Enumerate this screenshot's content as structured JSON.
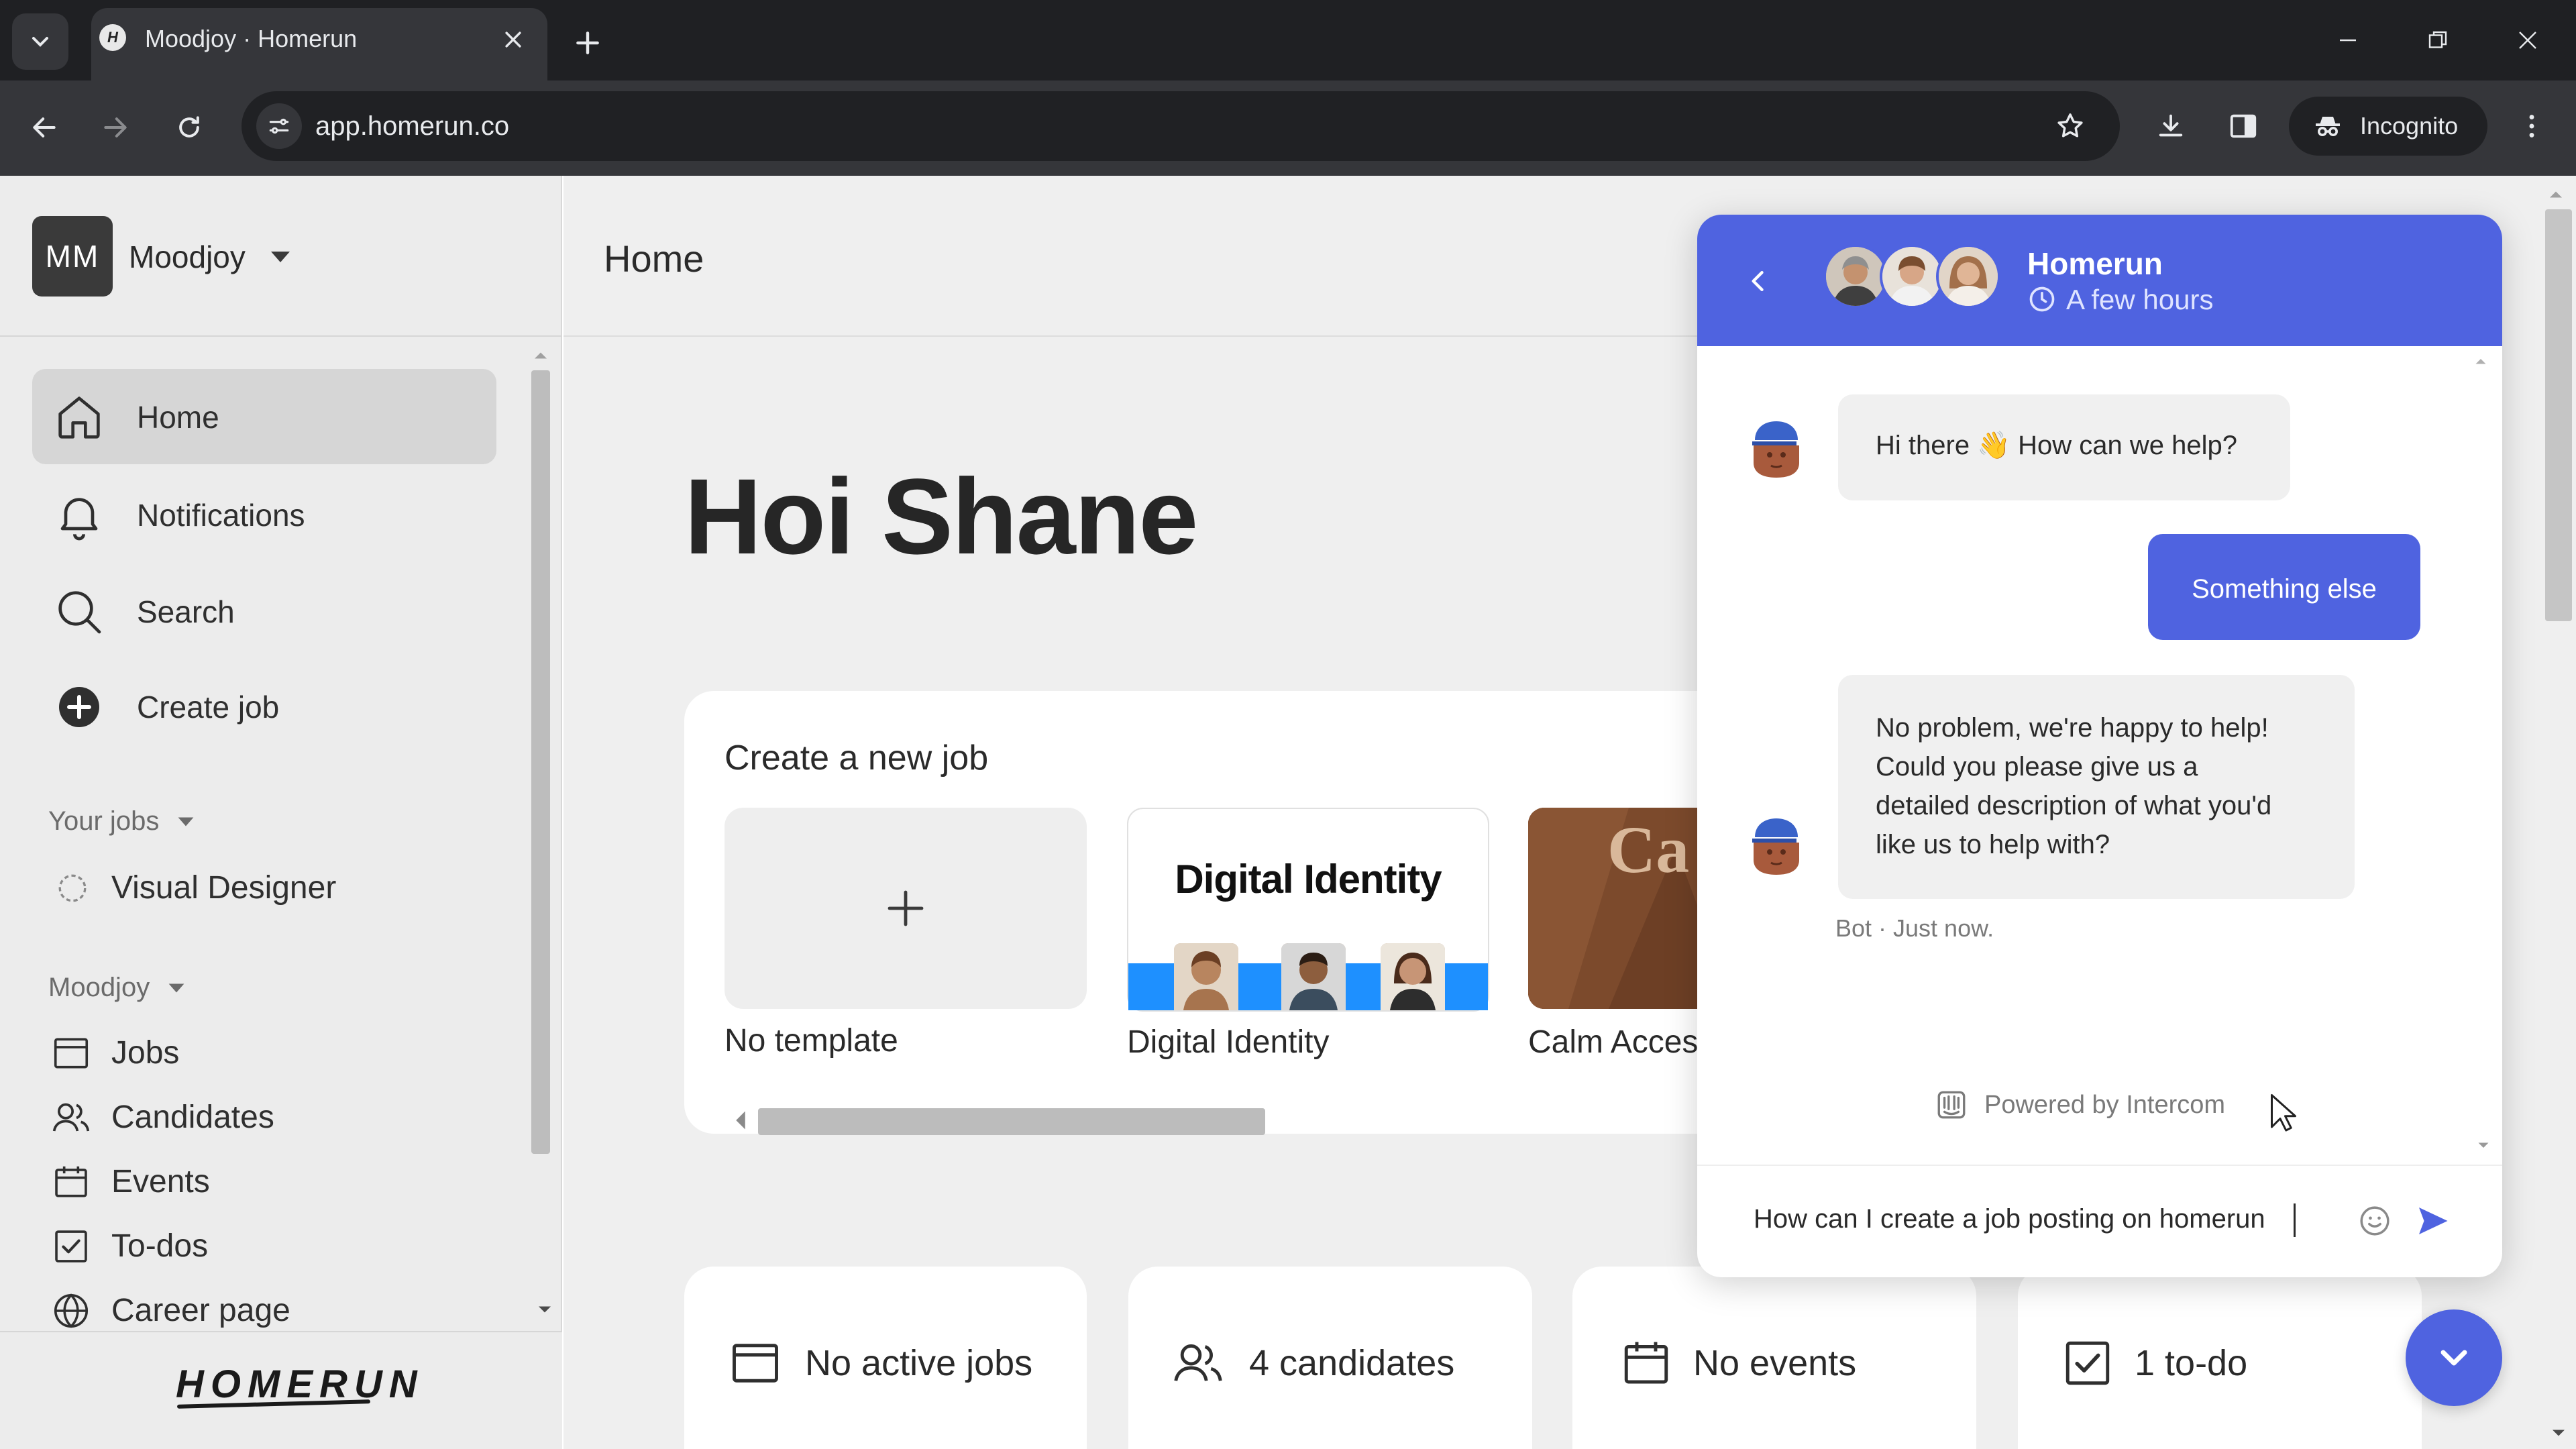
{
  "browser": {
    "tab_title": "Moodjoy · Homerun",
    "favicon_letter": "H",
    "url": "app.homerun.co",
    "incognito_label": "Incognito"
  },
  "sidebar": {
    "org_initials": "MM",
    "org_name": "Moodjoy",
    "nav": [
      {
        "label": "Home",
        "icon": "home-icon"
      },
      {
        "label": "Notifications",
        "icon": "bell-icon"
      },
      {
        "label": "Search",
        "icon": "search-icon"
      },
      {
        "label": "Create job",
        "icon": "plus-circle-icon"
      }
    ],
    "your_jobs_label": "Your jobs",
    "jobs": [
      {
        "label": "Visual Designer",
        "icon": "draft-circle-icon"
      }
    ],
    "org_section_label": "Moodjoy",
    "org_items": [
      {
        "label": "Jobs",
        "icon": "window-icon"
      },
      {
        "label": "Candidates",
        "icon": "people-icon"
      },
      {
        "label": "Events",
        "icon": "calendar-icon"
      },
      {
        "label": "To-dos",
        "icon": "checkbox-icon"
      },
      {
        "label": "Career page",
        "icon": "globe-icon"
      }
    ],
    "logo_text": "HOMERUN"
  },
  "main": {
    "page_title": "Home",
    "greeting": "Hoi Shane",
    "create_title": "Create a new job",
    "templates": [
      {
        "label": "No template"
      },
      {
        "label": "Digital Identity",
        "thumb_text": "Digital Identity"
      },
      {
        "label": "Calm Acces",
        "thumb_text": "Ca Acc"
      }
    ],
    "stats": [
      {
        "label": "No active jobs",
        "icon": "window-icon"
      },
      {
        "label": "4 candidates",
        "icon": "people-icon"
      },
      {
        "label": "No events",
        "icon": "calendar-icon"
      },
      {
        "label": "1 to-do",
        "icon": "checkbox-icon"
      }
    ]
  },
  "intercom": {
    "team_name": "Homerun",
    "reply_time": "A few hours",
    "messages": {
      "greeting": "Hi there 👋 How can we help?",
      "user_choice": "Something else",
      "bot_reply_lines": [
        "No problem, we're happy to help!",
        "Could you please give us a",
        "detailed description of what you'd",
        "like us to help with?"
      ],
      "bot_meta": "Bot · Just now."
    },
    "powered_by": "Powered by Intercom",
    "composer_value": "How can I create a job posting on homerun",
    "accent_color": "#4f63e0"
  }
}
